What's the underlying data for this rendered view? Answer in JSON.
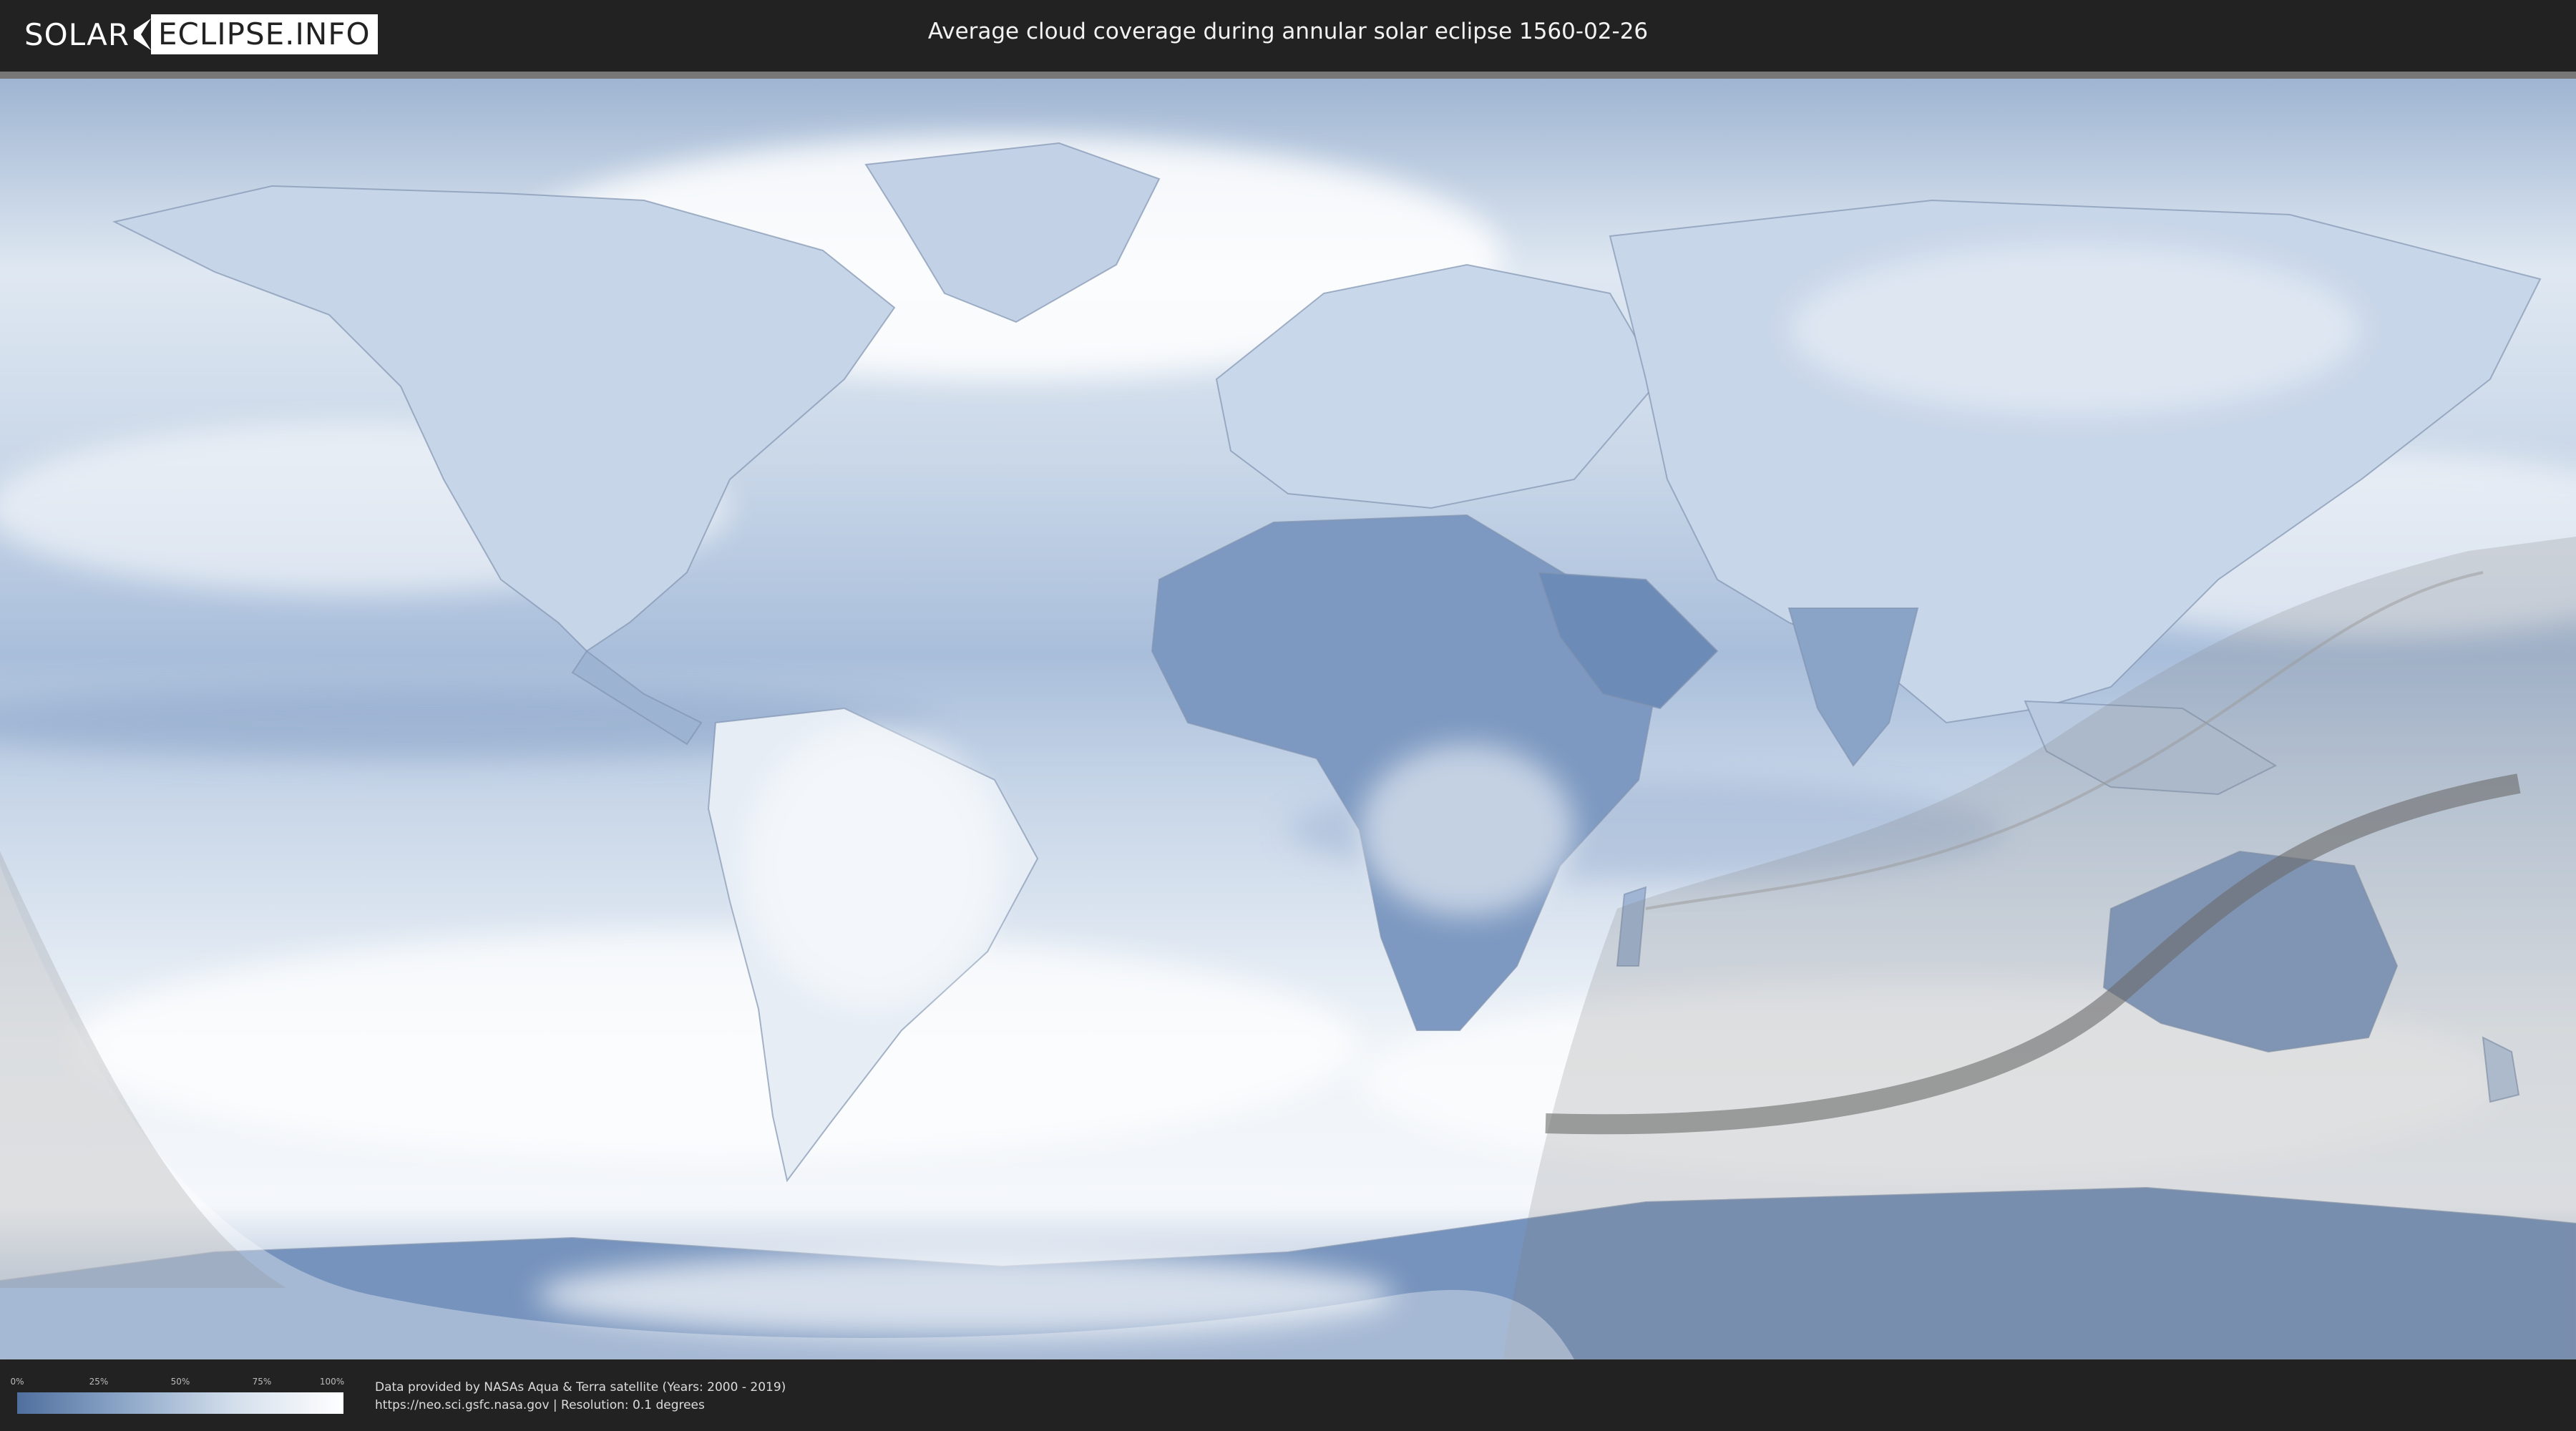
{
  "header": {
    "logo_solar": "SOLAR",
    "logo_eclipse": "ECLIPSE.INFO",
    "title": "Average cloud coverage during annular solar eclipse 1560-02-26"
  },
  "legend": {
    "ticks": [
      "0%",
      "25%",
      "50%",
      "75%",
      "100%"
    ],
    "scale_colors": [
      "#4f6f9e",
      "#8ea8c9",
      "#d4dfec",
      "#ffffff"
    ]
  },
  "credits": {
    "line1": "Data provided by NASAs Aqua & Terra satellite (Years: 2000 - 2019)",
    "line2": "https://neo.sci.gsfc.nasa.gov | Resolution: 0.1 degrees"
  },
  "map": {
    "ocean_color": "#b7c9e0",
    "land_dry_color": "#5f7fae",
    "cloud_color": "#ffffff",
    "eclipse_shade_color": "#808080",
    "central_path_color": "#6a6a6a"
  }
}
